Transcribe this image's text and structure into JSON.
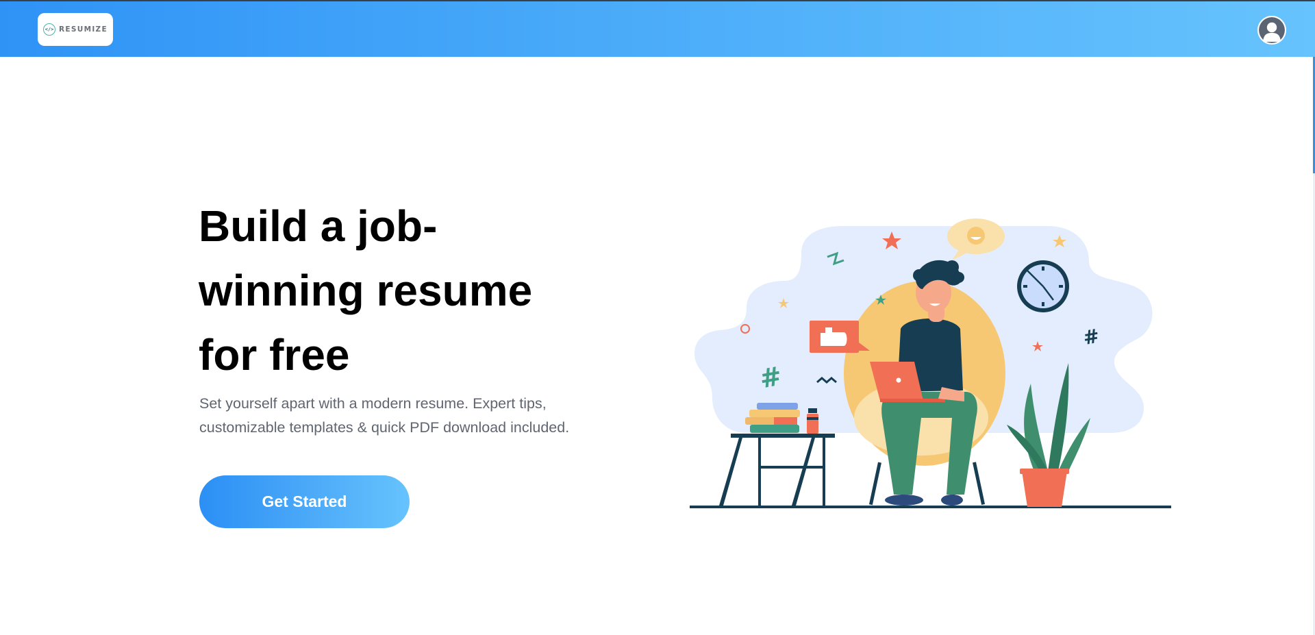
{
  "brand": {
    "logo_text": "RESUMIZE",
    "logo_mark": "</>"
  },
  "nav": {
    "avatar_icon": "user-avatar-icon"
  },
  "hero": {
    "headline": "Build a job-winning resume for free",
    "subtext": "Set yourself apart with a modern resume. Expert tips, customizable templates & quick PDF download included.",
    "cta_label": "Get Started"
  },
  "colors": {
    "nav_gradient_start": "#2f93f6",
    "nav_gradient_end": "#66c3fd",
    "headline": "#000000",
    "subtext": "#5f6670",
    "cta_gradient_start": "#2b8ff5",
    "cta_gradient_end": "#66c3fd",
    "illustration_bg": "#e3edfd",
    "accent_coral": "#f06f55",
    "accent_green": "#3f8f6e",
    "accent_yellow": "#f7c873",
    "dark_navy": "#163d52"
  }
}
